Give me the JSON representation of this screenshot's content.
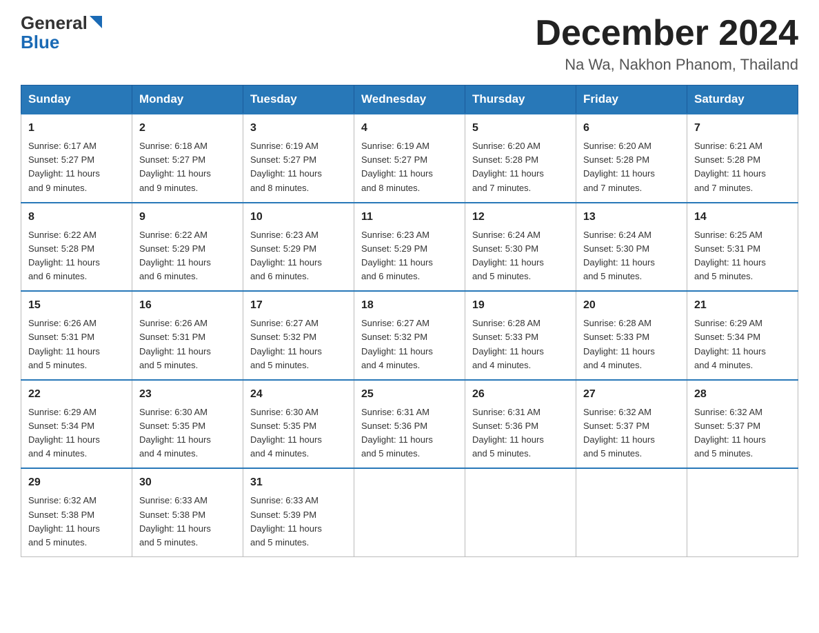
{
  "header": {
    "logo_line1": "General",
    "logo_line2": "Blue",
    "month_title": "December 2024",
    "subtitle": "Na Wa, Nakhon Phanom, Thailand"
  },
  "days_of_week": [
    "Sunday",
    "Monday",
    "Tuesday",
    "Wednesday",
    "Thursday",
    "Friday",
    "Saturday"
  ],
  "weeks": [
    [
      {
        "day": "1",
        "sunrise": "6:17 AM",
        "sunset": "5:27 PM",
        "daylight": "11 hours and 9 minutes."
      },
      {
        "day": "2",
        "sunrise": "6:18 AM",
        "sunset": "5:27 PM",
        "daylight": "11 hours and 9 minutes."
      },
      {
        "day": "3",
        "sunrise": "6:19 AM",
        "sunset": "5:27 PM",
        "daylight": "11 hours and 8 minutes."
      },
      {
        "day": "4",
        "sunrise": "6:19 AM",
        "sunset": "5:27 PM",
        "daylight": "11 hours and 8 minutes."
      },
      {
        "day": "5",
        "sunrise": "6:20 AM",
        "sunset": "5:28 PM",
        "daylight": "11 hours and 7 minutes."
      },
      {
        "day": "6",
        "sunrise": "6:20 AM",
        "sunset": "5:28 PM",
        "daylight": "11 hours and 7 minutes."
      },
      {
        "day": "7",
        "sunrise": "6:21 AM",
        "sunset": "5:28 PM",
        "daylight": "11 hours and 7 minutes."
      }
    ],
    [
      {
        "day": "8",
        "sunrise": "6:22 AM",
        "sunset": "5:28 PM",
        "daylight": "11 hours and 6 minutes."
      },
      {
        "day": "9",
        "sunrise": "6:22 AM",
        "sunset": "5:29 PM",
        "daylight": "11 hours and 6 minutes."
      },
      {
        "day": "10",
        "sunrise": "6:23 AM",
        "sunset": "5:29 PM",
        "daylight": "11 hours and 6 minutes."
      },
      {
        "day": "11",
        "sunrise": "6:23 AM",
        "sunset": "5:29 PM",
        "daylight": "11 hours and 6 minutes."
      },
      {
        "day": "12",
        "sunrise": "6:24 AM",
        "sunset": "5:30 PM",
        "daylight": "11 hours and 5 minutes."
      },
      {
        "day": "13",
        "sunrise": "6:24 AM",
        "sunset": "5:30 PM",
        "daylight": "11 hours and 5 minutes."
      },
      {
        "day": "14",
        "sunrise": "6:25 AM",
        "sunset": "5:31 PM",
        "daylight": "11 hours and 5 minutes."
      }
    ],
    [
      {
        "day": "15",
        "sunrise": "6:26 AM",
        "sunset": "5:31 PM",
        "daylight": "11 hours and 5 minutes."
      },
      {
        "day": "16",
        "sunrise": "6:26 AM",
        "sunset": "5:31 PM",
        "daylight": "11 hours and 5 minutes."
      },
      {
        "day": "17",
        "sunrise": "6:27 AM",
        "sunset": "5:32 PM",
        "daylight": "11 hours and 5 minutes."
      },
      {
        "day": "18",
        "sunrise": "6:27 AM",
        "sunset": "5:32 PM",
        "daylight": "11 hours and 4 minutes."
      },
      {
        "day": "19",
        "sunrise": "6:28 AM",
        "sunset": "5:33 PM",
        "daylight": "11 hours and 4 minutes."
      },
      {
        "day": "20",
        "sunrise": "6:28 AM",
        "sunset": "5:33 PM",
        "daylight": "11 hours and 4 minutes."
      },
      {
        "day": "21",
        "sunrise": "6:29 AM",
        "sunset": "5:34 PM",
        "daylight": "11 hours and 4 minutes."
      }
    ],
    [
      {
        "day": "22",
        "sunrise": "6:29 AM",
        "sunset": "5:34 PM",
        "daylight": "11 hours and 4 minutes."
      },
      {
        "day": "23",
        "sunrise": "6:30 AM",
        "sunset": "5:35 PM",
        "daylight": "11 hours and 4 minutes."
      },
      {
        "day": "24",
        "sunrise": "6:30 AM",
        "sunset": "5:35 PM",
        "daylight": "11 hours and 4 minutes."
      },
      {
        "day": "25",
        "sunrise": "6:31 AM",
        "sunset": "5:36 PM",
        "daylight": "11 hours and 5 minutes."
      },
      {
        "day": "26",
        "sunrise": "6:31 AM",
        "sunset": "5:36 PM",
        "daylight": "11 hours and 5 minutes."
      },
      {
        "day": "27",
        "sunrise": "6:32 AM",
        "sunset": "5:37 PM",
        "daylight": "11 hours and 5 minutes."
      },
      {
        "day": "28",
        "sunrise": "6:32 AM",
        "sunset": "5:37 PM",
        "daylight": "11 hours and 5 minutes."
      }
    ],
    [
      {
        "day": "29",
        "sunrise": "6:32 AM",
        "sunset": "5:38 PM",
        "daylight": "11 hours and 5 minutes."
      },
      {
        "day": "30",
        "sunrise": "6:33 AM",
        "sunset": "5:38 PM",
        "daylight": "11 hours and 5 minutes."
      },
      {
        "day": "31",
        "sunrise": "6:33 AM",
        "sunset": "5:39 PM",
        "daylight": "11 hours and 5 minutes."
      },
      null,
      null,
      null,
      null
    ]
  ],
  "labels": {
    "sunrise": "Sunrise:",
    "sunset": "Sunset:",
    "daylight": "Daylight:"
  }
}
